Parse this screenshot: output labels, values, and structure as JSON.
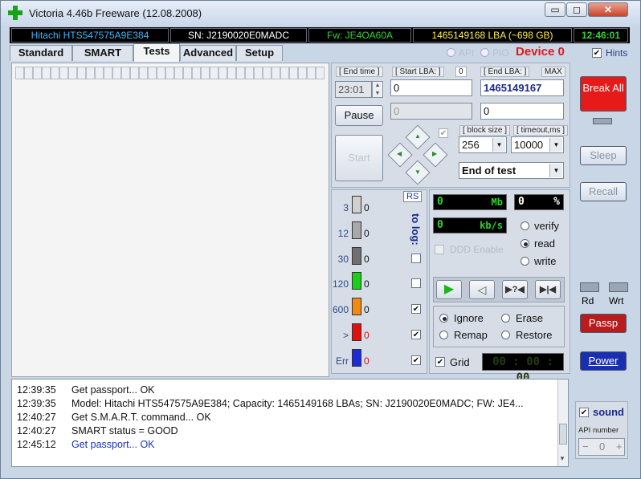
{
  "window": {
    "title": "Victoria 4.46b Freeware (12.08.2008)",
    "controls": {
      "minimize": "▭",
      "maximize": "◻",
      "close": "✕"
    }
  },
  "infobar": {
    "model": "Hitachi HTS547575A9E384",
    "serial": "SN: J2190020E0MADC",
    "firmware": "Fw: JE4OA60A",
    "capacity": "1465149168 LBA (~698 GB)",
    "clock": "12:46:01"
  },
  "tabs": [
    "Standard",
    "SMART",
    "Tests",
    "Advanced",
    "Setup"
  ],
  "active_tab": "Tests",
  "mode": {
    "api": "API",
    "pio": "PIO",
    "device": "Device 0",
    "hints": "Hints",
    "hints_checked": true
  },
  "tests": {
    "end_time_label": "[ End time ]",
    "end_time_value": "23:01",
    "start_lba_label": "[ Start LBA: ]",
    "start_lba_small": "0",
    "start_lba_value": "0",
    "end_lba_label": "[ End LBA: ]",
    "end_lba_max": "MAX",
    "end_lba_value": "1465149167",
    "pause_label": "Pause",
    "start_label": "Start",
    "cur_lba_value": "0",
    "cur_lba2_value": "0",
    "block_size_label": "[ block size ]",
    "block_size_value": "256",
    "timeout_label": "[ timeout,ms ]",
    "timeout_value": "10000",
    "end_action_value": "End of test"
  },
  "timing": {
    "rs_label": "RS",
    "to_log_label": "to log:",
    "rows": [
      {
        "ms": "3",
        "count": "0",
        "color": "#d0d0d0",
        "log": false,
        "show_chk": false
      },
      {
        "ms": "12",
        "count": "0",
        "color": "#a8a8a8",
        "log": false,
        "show_chk": false
      },
      {
        "ms": "30",
        "count": "0",
        "color": "#707070",
        "log": false,
        "show_chk": true
      },
      {
        "ms": "120",
        "count": "0",
        "color": "#18d018",
        "log": false,
        "show_chk": true
      },
      {
        "ms": "600",
        "count": "0",
        "color": "#f08a10",
        "log": true,
        "show_chk": true
      },
      {
        "ms": ">",
        "count": "0",
        "color": "#e01010",
        "log": true,
        "show_chk": true
      },
      {
        "ms": "Err",
        "count": "0",
        "color": "#1c2ad8",
        "log": true,
        "show_chk": true
      }
    ]
  },
  "stats": {
    "mb_value": "0",
    "mb_unit": "Mb",
    "pct_value": "0",
    "pct_unit": "%",
    "kbs_value": "0",
    "kbs_unit": "kb/s",
    "ddd_label": "DDD Enable",
    "verify_label": "verify",
    "read_label": "read",
    "write_label": "write",
    "ignore_label": "Ignore",
    "erase_label": "Erase",
    "remap_label": "Remap",
    "restore_label": "Restore",
    "grid_label": "Grid",
    "grid_time": "00 : 00 : 00"
  },
  "log": [
    {
      "time": "12:39:35",
      "text": "Get passport... OK",
      "blue": false
    },
    {
      "time": "12:39:35",
      "text": "Model: Hitachi HTS547575A9E384; Capacity: 1465149168 LBAs; SN: J2190020E0MADC; FW: JE4...",
      "blue": false
    },
    {
      "time": "12:40:27",
      "text": "Get S.M.A.R.T. command... OK",
      "blue": false
    },
    {
      "time": "12:40:27",
      "text": "SMART status = GOOD",
      "blue": false
    },
    {
      "time": "12:45:12",
      "text": "Get passport... OK",
      "blue": true
    }
  ],
  "right": {
    "break_all": "Break All",
    "sleep": "Sleep",
    "recall": "Recall",
    "rd": "Rd",
    "wrt": "Wrt",
    "passp": "Passp",
    "power": "Power",
    "sound": "Sound",
    "sound_label": "sound",
    "api_number_label": "API number",
    "api_number_value": "0",
    "minus": "−",
    "plus": "+"
  }
}
